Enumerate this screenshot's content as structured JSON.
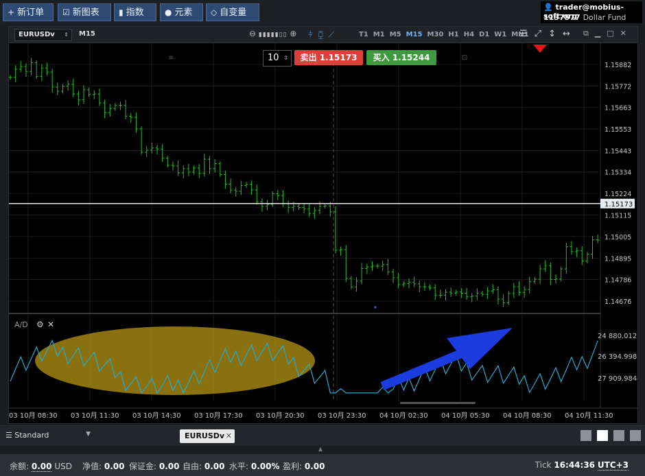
{
  "toolbar": {
    "new_order": "新订单",
    "new_chart": "新图表",
    "indicators": "指数",
    "elements": "元素",
    "variables": "自变量"
  },
  "account": {
    "email": "trader@mobius-soft.org",
    "number": "1137577",
    "name": "Dollar Fund"
  },
  "chart": {
    "symbol": "EURUSDv",
    "timeframe": "M15",
    "timeframes": [
      "T1",
      "M1",
      "M5",
      "M15",
      "M30",
      "H1",
      "H4",
      "D1",
      "W1",
      "MN1"
    ],
    "active_timeframe": "M15",
    "quantity": "10",
    "sell_label": "卖出 1.15173",
    "buy_label": "买入 1.15244",
    "indicator_label": "A/D",
    "bar_color": "#22c222",
    "indicator_color": "#2aaad0",
    "highlight_color": "#a88a12",
    "arrow_color": "#1b3de0",
    "marker_color": "#dd1a1a"
  },
  "chart_data": {
    "type": "bar",
    "price_axis": {
      "ylim": [
        1.1462,
        1.1599
      ],
      "ticks": [
        "1.15882",
        "1.15772",
        "1.15663",
        "1.15553",
        "1.15443",
        "1.15334",
        "1.15224",
        "1.15115",
        "1.15005",
        "1.14895",
        "1.14786",
        "1.14676"
      ],
      "current": "1.15173"
    },
    "indicator_axis": {
      "ticks": [
        "24 880.0129",
        "26 394.9986",
        "27 909.9844"
      ]
    },
    "x_ticks": [
      "03 10月 08:30",
      "03 10月 11:30",
      "03 10月 14:30",
      "03 10月 17:30",
      "03 10月 20:30",
      "03 10月 23:30",
      "04 10月 02:30",
      "04 10月 05:30",
      "04 10月 08:30",
      "04 10月 11:30"
    ],
    "close": [
      1.15816,
      1.15858,
      1.15871,
      1.15846,
      1.15891,
      1.15821,
      1.15863,
      1.15843,
      1.15766,
      1.15745,
      1.15771,
      1.15781,
      1.15731,
      1.15701,
      1.15753,
      1.15728,
      1.15731,
      1.15686,
      1.15636,
      1.15657,
      1.15673,
      1.15673,
      1.15618,
      1.15613,
      1.15554,
      1.15434,
      1.15445,
      1.15456,
      1.15451,
      1.15404,
      1.15368,
      1.15365,
      1.15329,
      1.15351,
      1.15333,
      1.15354,
      1.15327,
      1.15399,
      1.15351,
      1.15376,
      1.15321,
      1.15272,
      1.15242,
      1.15236,
      1.15265,
      1.15271,
      1.15242,
      1.15183,
      1.15159,
      1.15168,
      1.15223,
      1.15214,
      1.15172,
      1.15153,
      1.15159,
      1.15153,
      1.15147,
      1.15123,
      1.15138,
      1.15159,
      1.15161,
      1.15131,
      1.14935,
      1.14938,
      1.14792,
      1.14748,
      1.14778,
      1.14842,
      1.1485,
      1.14855,
      1.14854,
      1.14862,
      1.14825,
      1.14795,
      1.1476,
      1.14765,
      1.14773,
      1.14764,
      1.14749,
      1.14749,
      1.14743,
      1.14706,
      1.14706,
      1.14721,
      1.14717,
      1.14722,
      1.14716,
      1.14699,
      1.14701,
      1.14717,
      1.1471,
      1.14728,
      1.14734,
      1.14686,
      1.14667,
      1.14715,
      1.14749,
      1.1472,
      1.14735,
      1.14776,
      1.14787,
      1.1484,
      1.14857,
      1.14786,
      1.14788,
      1.1484,
      1.14953,
      1.14928,
      1.14932,
      1.1488,
      1.14915,
      1.14988,
      1.14987
    ]
  },
  "tabs": {
    "workspace": "Standard",
    "symbol_tab": "EURUSDv"
  },
  "status": {
    "balance_label": "余额:",
    "balance": "0.00",
    "currency": "USD",
    "equity_label": "净值:",
    "equity": "0.00",
    "margin_label": "保证金:",
    "margin": "0.00",
    "free_label": "自由:",
    "free": "0.00",
    "level_label": "水平:",
    "level": "0.00%",
    "profit_label": "盈利:",
    "profit": "0.00",
    "tick_label": "Tick",
    "time": "16:44:36",
    "tz": "UTC+3"
  }
}
